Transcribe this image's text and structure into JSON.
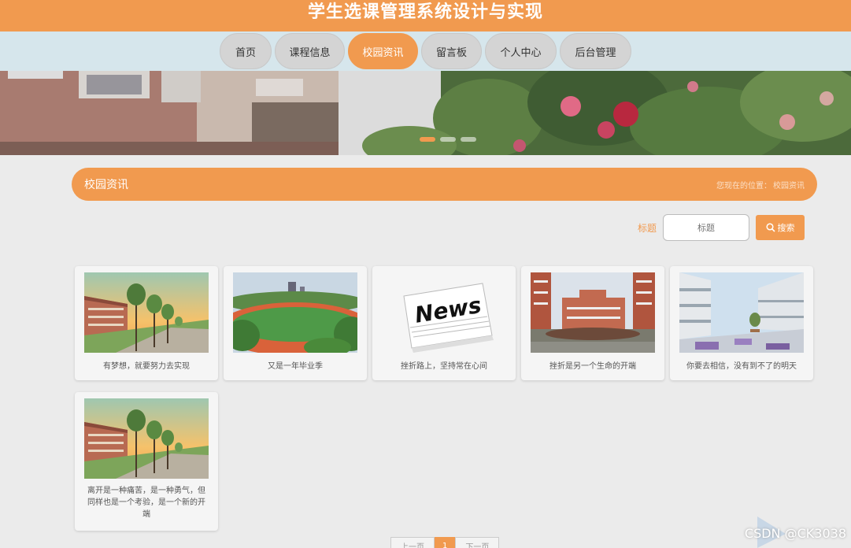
{
  "header": {
    "title": "学生选课管理系统设计与实现"
  },
  "nav": {
    "items": [
      {
        "label": "首页",
        "active": false
      },
      {
        "label": "课程信息",
        "active": false
      },
      {
        "label": "校园资讯",
        "active": true
      },
      {
        "label": "留言板",
        "active": false
      },
      {
        "label": "个人中心",
        "active": false
      },
      {
        "label": "后台管理",
        "active": false
      }
    ]
  },
  "section": {
    "title": "校园资讯",
    "breadcrumb_prefix": "您现在的位置：",
    "breadcrumb_current": "校园资讯"
  },
  "search": {
    "label": "标题",
    "placeholder": "标题",
    "button_label": "搜索"
  },
  "news": [
    {
      "caption": "有梦想，就要努力去实现",
      "image": "campus-sunset"
    },
    {
      "caption": "又是一年毕业季",
      "image": "sports-track"
    },
    {
      "caption": "挫折路上，坚持常在心间",
      "image": "newspaper"
    },
    {
      "caption": "挫折是另一个生命的开端",
      "image": "campus-buildings"
    },
    {
      "caption": "你要去相信，没有到不了的明天",
      "image": "modern-plaza"
    },
    {
      "caption": "离开是一种痛苦，是一种勇气，但同样也是一个考验，是一个新的开端",
      "image": "campus-sunset"
    }
  ],
  "newspaper_word": "News",
  "pagination": {
    "prev": "上一页",
    "current": "1",
    "next": "下一页"
  },
  "watermark": "CSDN @CK3038",
  "colors": {
    "accent": "#f19a4f",
    "nav_bg": "#d6e6ec",
    "page_bg": "#ebebeb"
  }
}
